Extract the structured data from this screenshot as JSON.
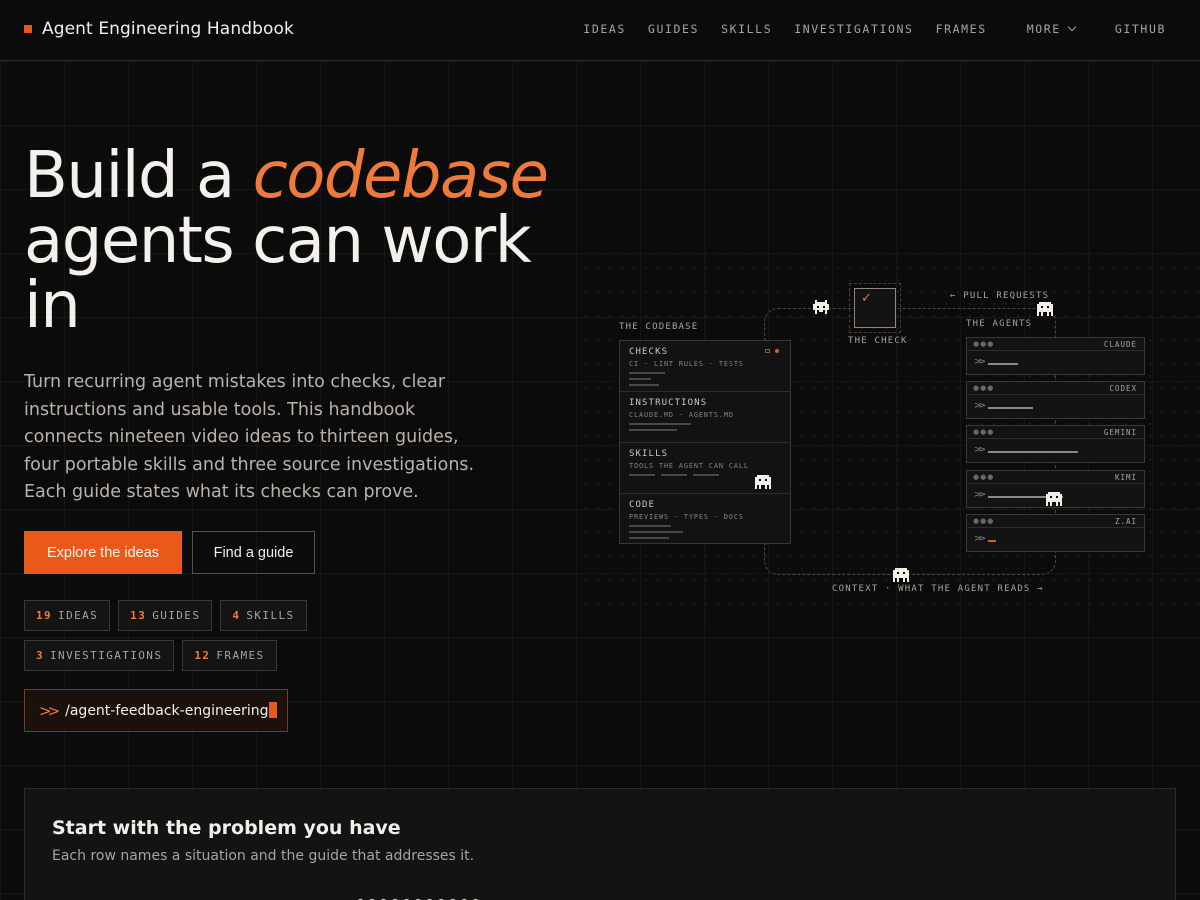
{
  "header": {
    "brand": "Agent Engineering Handbook",
    "nav": [
      "IDEAS",
      "GUIDES",
      "SKILLS",
      "INVESTIGATIONS",
      "FRAMES"
    ],
    "more": "MORE",
    "github": "GITHUB"
  },
  "hero": {
    "title_a": "Build a ",
    "title_em": "codebase",
    "title_b": "agents can work in",
    "subtitle": "Turn recurring agent mistakes into checks, clear instructions and usable tools. This handbook connects nineteen video ideas to thirteen guides, four portable skills and three source investigations. Each guide states what its checks can prove.",
    "primary_cta": "Explore the ideas",
    "secondary_cta": "Find a guide",
    "chips": [
      {
        "count": "19",
        "label": "IDEAS"
      },
      {
        "count": "13",
        "label": "GUIDES"
      },
      {
        "count": "4",
        "label": "SKILLS"
      },
      {
        "count": "3",
        "label": "INVESTIGATIONS"
      },
      {
        "count": "12",
        "label": "FRAMES"
      }
    ],
    "command": "/agent-feedback-engineering"
  },
  "diagram": {
    "codebase_label": "THE CODEBASE",
    "check_label": "THE CHECK",
    "agents_label": "THE AGENTS",
    "pull_requests": "← PULL REQUESTS",
    "context": "CONTEXT · WHAT THE AGENT READS →",
    "codebase_rows": [
      {
        "title": "CHECKS",
        "sub": "CI · LINT RULES · TESTS"
      },
      {
        "title": "INSTRUCTIONS",
        "sub": "CLAUDE.MD · AGENTS.MD"
      },
      {
        "title": "SKILLS",
        "sub": "TOOLS THE AGENT CAN CALL"
      },
      {
        "title": "CODE",
        "sub": "PREVIEWS · TYPES · DOCS"
      }
    ],
    "agents": [
      {
        "name": "CLAUDE",
        "progress": 0.2
      },
      {
        "name": "CODEX",
        "progress": 0.3
      },
      {
        "name": "GEMINI",
        "progress": 0.6
      },
      {
        "name": "KIMI",
        "progress": 0.5
      },
      {
        "name": "Z.AI",
        "progress": 0.05
      }
    ],
    "accent": "#e8591a"
  },
  "problems": {
    "title": "Start with the problem you have",
    "subtitle": "Each row names a situation and the guide that addresses it."
  }
}
